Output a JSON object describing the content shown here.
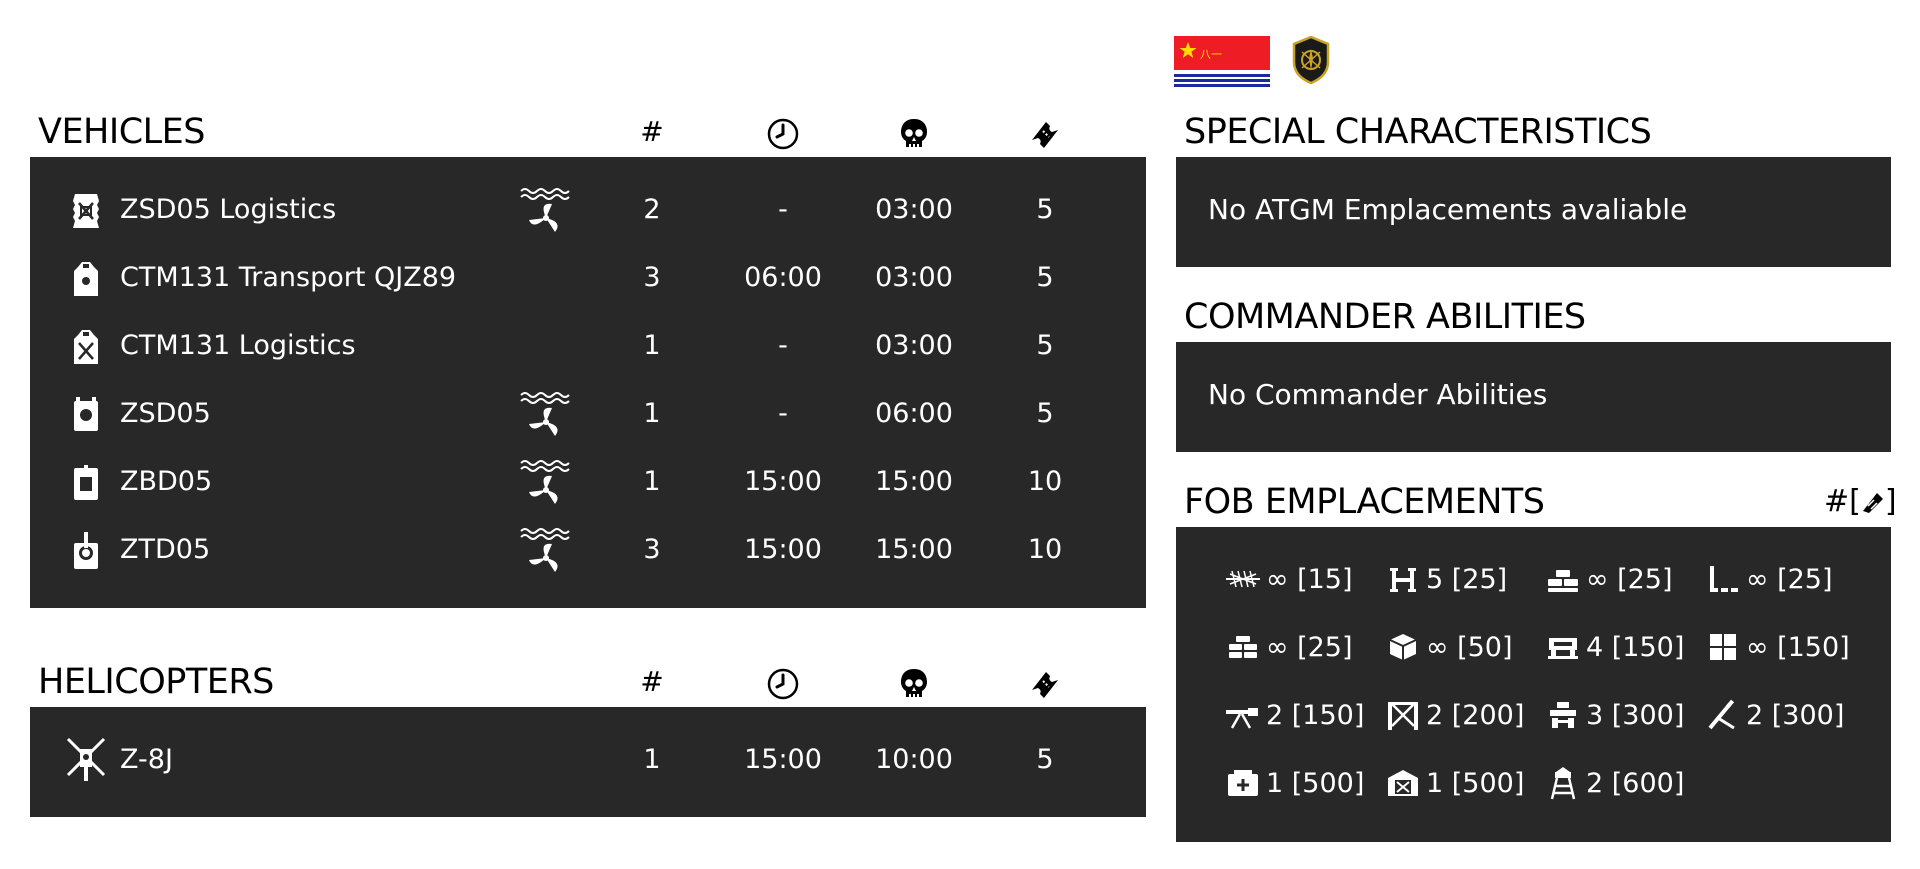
{
  "vehicles": {
    "title": "VEHICLES",
    "headers": {
      "count": "#"
    },
    "rows": [
      {
        "name": "ZSD05 Logistics",
        "amphibious": true,
        "count": "2",
        "delay": "-",
        "respawn": "03:00",
        "tickets": "5"
      },
      {
        "name": "CTM131 Transport QJZ89",
        "amphibious": false,
        "count": "3",
        "delay": "06:00",
        "respawn": "03:00",
        "tickets": "5"
      },
      {
        "name": "CTM131 Logistics",
        "amphibious": false,
        "count": "1",
        "delay": "-",
        "respawn": "03:00",
        "tickets": "5"
      },
      {
        "name": "ZSD05",
        "amphibious": true,
        "count": "1",
        "delay": "-",
        "respawn": "06:00",
        "tickets": "5"
      },
      {
        "name": "ZBD05",
        "amphibious": true,
        "count": "1",
        "delay": "15:00",
        "respawn": "15:00",
        "tickets": "10"
      },
      {
        "name": "ZTD05",
        "amphibious": true,
        "count": "3",
        "delay": "15:00",
        "respawn": "15:00",
        "tickets": "10"
      }
    ]
  },
  "helicopters": {
    "title": "HELICOPTERS",
    "headers": {
      "count": "#"
    },
    "rows": [
      {
        "name": "Z-8J",
        "count": "1",
        "delay": "15:00",
        "respawn": "10:00",
        "tickets": "5"
      }
    ]
  },
  "special": {
    "title": "SPECIAL CHARACTERISTICS",
    "text": "No ATGM Emplacements avaliable"
  },
  "commander": {
    "title": "COMMANDER ABILITIES",
    "text": "No Commander Abilities"
  },
  "fob": {
    "title": "FOB EMPLACEMENTS",
    "legend": "#[",
    "legend_close": "]",
    "items": [
      {
        "icon": "razor-wire-icon",
        "label": "∞ [15]"
      },
      {
        "icon": "tank-trap-icon",
        "label": "5 [25]"
      },
      {
        "icon": "sandbag-wall-icon",
        "label": "∞ [25]"
      },
      {
        "icon": "wall-corner-icon",
        "label": "∞ [25]"
      },
      {
        "icon": "sandbag-stack-icon",
        "label": "∞ [25]"
      },
      {
        "icon": "ammo-crate-icon",
        "label": "∞ [50]"
      },
      {
        "icon": "bunker-icon",
        "label": "4 [150]"
      },
      {
        "icon": "window-barricade-icon",
        "label": "∞ [150]"
      },
      {
        "icon": "machine-gun-icon",
        "label": "2 [150]"
      },
      {
        "icon": "gate-icon",
        "label": "2 [200]"
      },
      {
        "icon": "fortification-icon",
        "label": "3 [300]"
      },
      {
        "icon": "mortar-icon",
        "label": "2 [300]"
      },
      {
        "icon": "supply-depot-icon",
        "label": "1 [500]"
      },
      {
        "icon": "repair-station-icon",
        "label": "1 [500]"
      },
      {
        "icon": "watchtower-icon",
        "label": "2 [600]"
      }
    ]
  },
  "colors": {
    "panel": "#282828",
    "text": "#ffffff",
    "flag_red": "#EE1C25",
    "flag_blue": "#1B2A9E",
    "flag_star": "#FFDE00"
  }
}
